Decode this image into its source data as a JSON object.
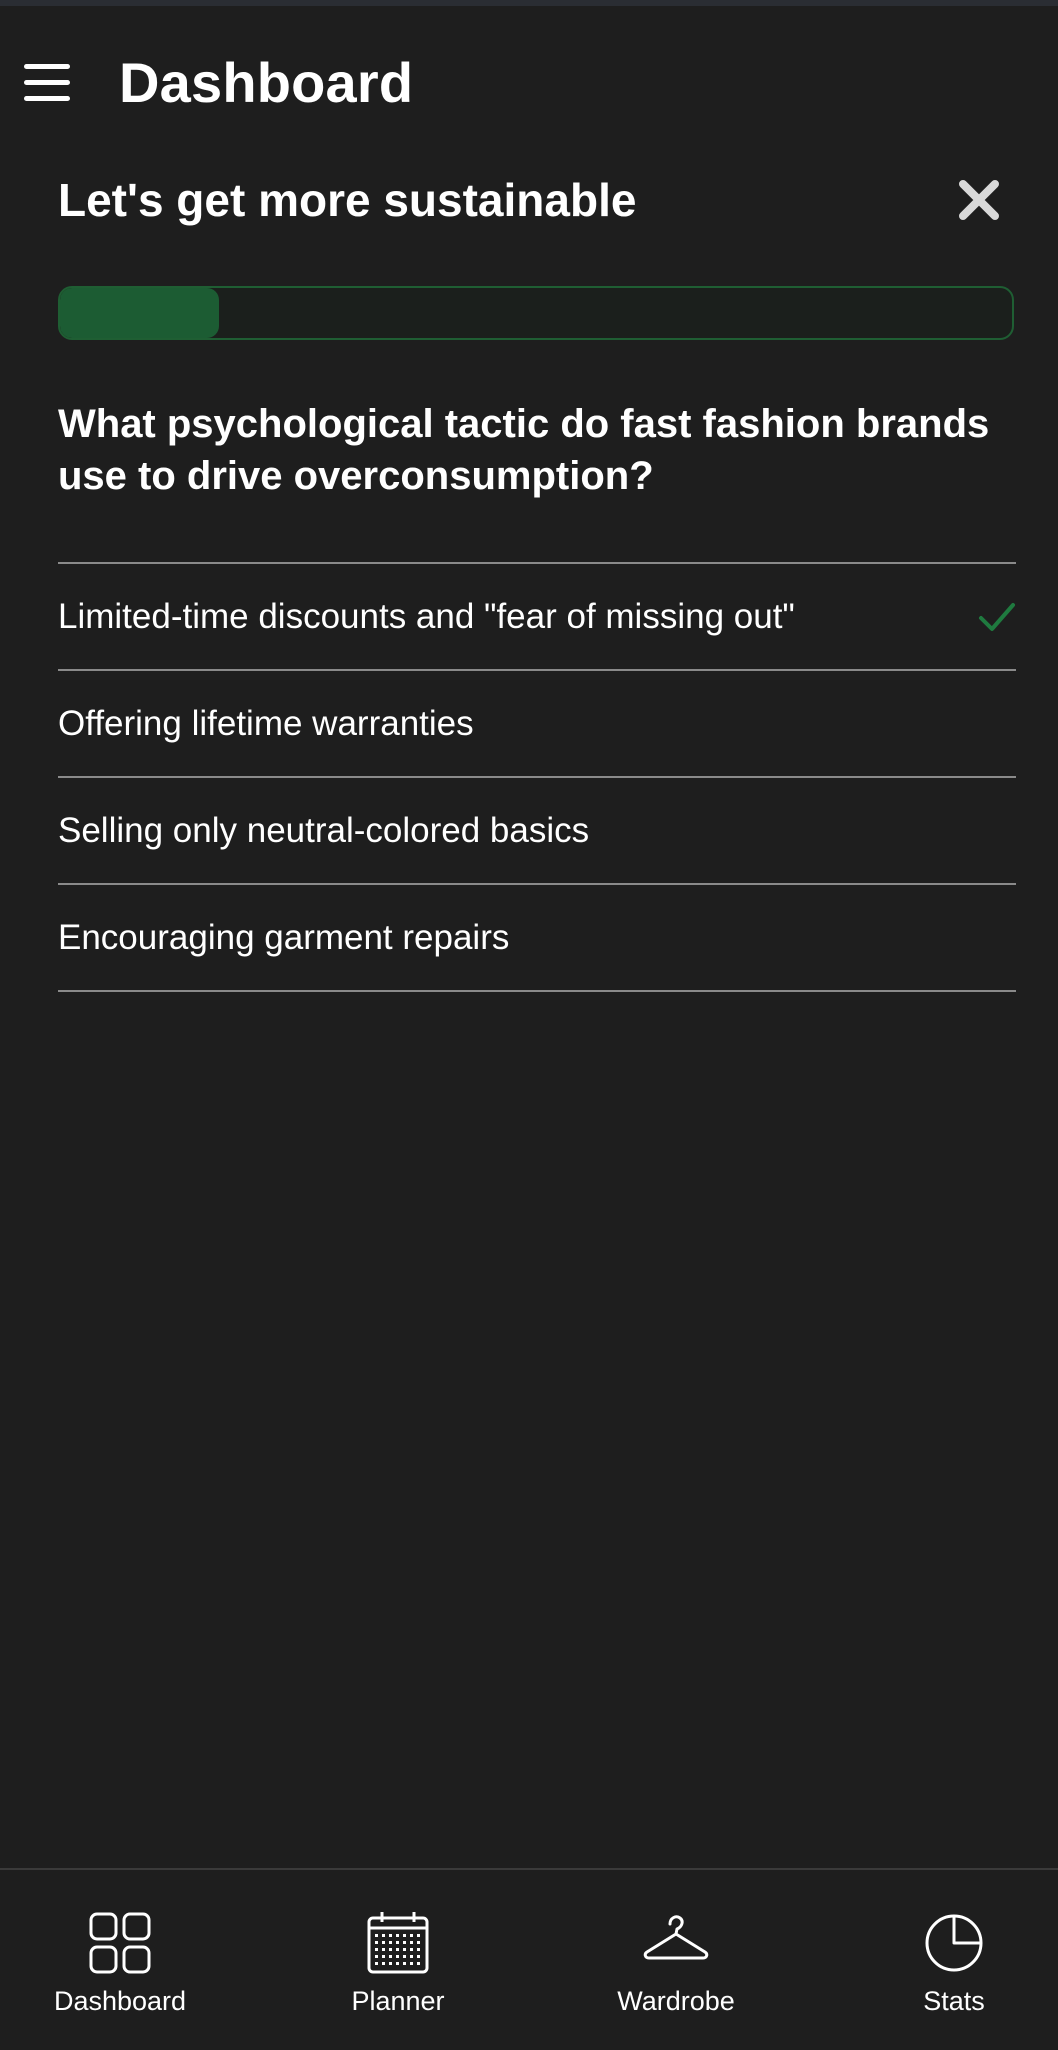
{
  "header": {
    "title": "Dashboard",
    "menu_icon": "hamburger-menu-icon"
  },
  "quiz": {
    "heading": "Let's get more sustainable",
    "close_icon": "close-icon",
    "progress_fraction": 0.167,
    "question": "What psychological tactic do fast fashion brands use to drive overconsumption?",
    "answers": [
      {
        "label": "Limited-time discounts and \"fear of missing out\"",
        "selected": true
      },
      {
        "label": "Offering lifetime warranties",
        "selected": false
      },
      {
        "label": "Selling only neutral-colored basics",
        "selected": false
      },
      {
        "label": "Encouraging garment repairs",
        "selected": false
      }
    ]
  },
  "bottom_nav": {
    "items": [
      {
        "label": "Dashboard",
        "icon": "grid-icon"
      },
      {
        "label": "Planner",
        "icon": "calendar-icon"
      },
      {
        "label": "Wardrobe",
        "icon": "hanger-icon"
      },
      {
        "label": "Stats",
        "icon": "pie-chart-icon"
      }
    ]
  },
  "colors": {
    "background": "#1e1e1e",
    "accent_green": "#1c5c33",
    "check_green": "#1f7a3f",
    "divider": "#8a8a8a"
  }
}
